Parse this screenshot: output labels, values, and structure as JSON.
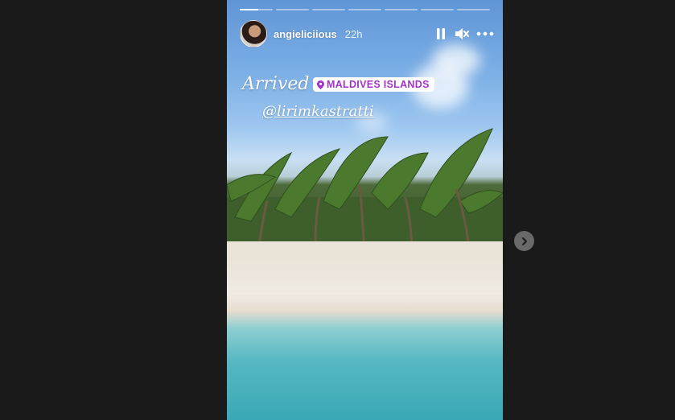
{
  "story": {
    "progress_segments": [
      {
        "fill": 0.55
      },
      {
        "fill": 0
      },
      {
        "fill": 0
      },
      {
        "fill": 0
      },
      {
        "fill": 0
      },
      {
        "fill": 0
      },
      {
        "fill": 0
      }
    ],
    "user": {
      "username": "angieliciious",
      "posted_ago": "22h",
      "avatar_icon": "profile-avatar"
    },
    "controls": {
      "pause_icon": "pause-icon",
      "mute_icon": "muted-speaker-icon",
      "more_icon": "more-dots-icon"
    },
    "stickers": {
      "caption": "Arrived",
      "location_pin_icon": "location-pin-icon",
      "location": "MALDIVES ISLANDS",
      "mention": "@lirimkastratti"
    }
  },
  "navigation": {
    "next_icon": "chevron-right-icon"
  },
  "colors": {
    "page_bg": "#1a1a1a",
    "location_text": "#a233c7",
    "ui_white": "#ffffff"
  }
}
